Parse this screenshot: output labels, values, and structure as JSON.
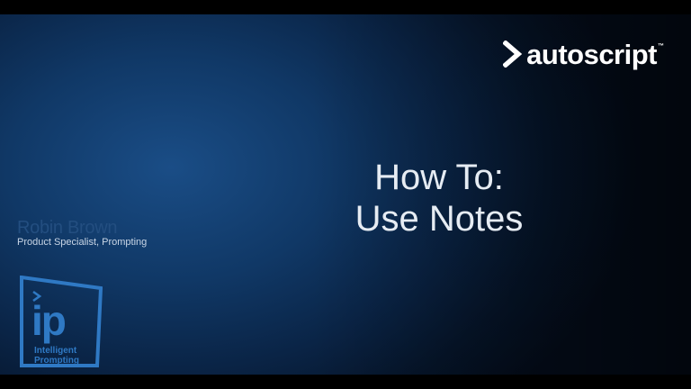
{
  "brand": {
    "name": "autoscript",
    "trademark": "™",
    "icon": "chevron-right-icon",
    "color": "#ffffff"
  },
  "title": {
    "line1": "How To:",
    "line2": "Use Notes"
  },
  "presenter": {
    "name": "Robin Brown",
    "role": "Product Specialist, Prompting"
  },
  "ip_logo": {
    "mark": "ip",
    "caption_line1": "Intelligent",
    "caption_line2": "Prompting",
    "icon": "intelligent-prompting-logo-icon",
    "color": "#2f79c4"
  },
  "colors": {
    "background_center": "#1a4d86",
    "background_edge": "#040d1c",
    "title_text": "#e6ecf3",
    "presenter_name": "#234e80"
  }
}
